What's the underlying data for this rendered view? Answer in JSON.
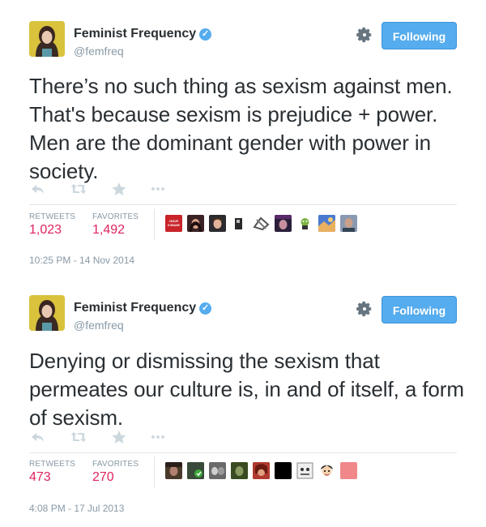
{
  "tweets": [
    {
      "name": "Feminist Frequency",
      "handle": "@femfreq",
      "follow_label": "Following",
      "text": "There’s no such thing as sexism against men. That's because sexism is prejudice + power. Men are the dominant gender with power in society.",
      "retweets_label": "RETWEETS",
      "retweets": "1,023",
      "favorites_label": "FAVORITES",
      "favorites": "1,492",
      "timestamp": "10:25 PM - 14 Nov 2014",
      "favoriter_badge": "#SAVE KOBANE"
    },
    {
      "name": "Feminist Frequency",
      "handle": "@femfreq",
      "follow_label": "Following",
      "text": "Denying or dismissing the sexism that permeates our culture is, in and of itself, a form of sexism.",
      "retweets_label": "RETWEETS",
      "retweets": "473",
      "favorites_label": "FAVORITES",
      "favorites": "270",
      "timestamp": "4:08 PM - 17 Jul 2013"
    }
  ],
  "icons": {
    "verified": "verified-badge-icon",
    "settings": "gear-icon",
    "reply": "reply-icon",
    "retweet": "retweet-icon",
    "favorite": "star-icon",
    "more": "more-icon"
  },
  "colors": {
    "accent": "#55acee",
    "stat_value": "#e0245e",
    "muted": "#8899a6",
    "text": "#292f33",
    "divider": "#e1e8ed"
  }
}
